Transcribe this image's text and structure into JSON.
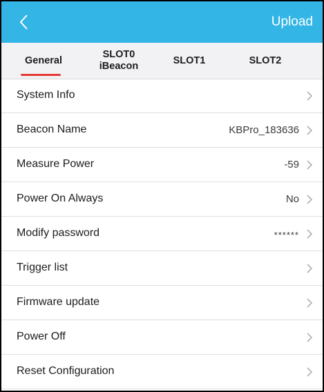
{
  "header": {
    "back_icon": "chevron-left-icon",
    "upload_label": "Upload",
    "bg_color": "#33b5e5"
  },
  "tabs": [
    {
      "line1": "General",
      "line2": ""
    },
    {
      "line1": "SLOT0",
      "line2": "iBeacon"
    },
    {
      "line1": "SLOT1",
      "line2": ""
    },
    {
      "line1": "SLOT2",
      "line2": ""
    }
  ],
  "selected_tab": "General",
  "accent_color": "#e53935",
  "rows": [
    {
      "label": "System Info",
      "value": ""
    },
    {
      "label": "Beacon Name",
      "value": "KBPro_183636"
    },
    {
      "label": "Measure Power",
      "value": "-59"
    },
    {
      "label": "Power On Always",
      "value": "No"
    },
    {
      "label": "Modify password",
      "value": "******"
    },
    {
      "label": "Trigger list",
      "value": ""
    },
    {
      "label": "Firmware update",
      "value": ""
    },
    {
      "label": "Power Off",
      "value": ""
    },
    {
      "label": "Reset Configuration",
      "value": ""
    }
  ]
}
